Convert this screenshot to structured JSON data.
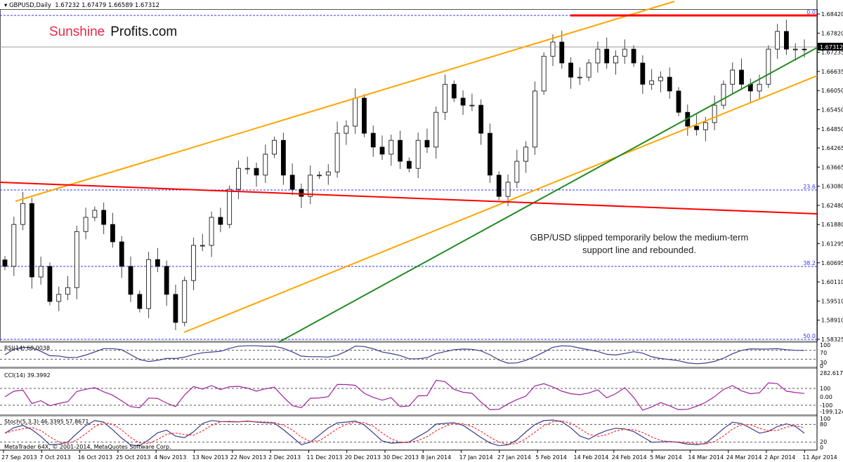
{
  "header": {
    "symbol": "GBPUSD,Daily",
    "ohlc": "1.67232 1.67479 1.66589 1.67312"
  },
  "logo": {
    "part1": "Sunshine",
    "part2": "Profits.com"
  },
  "annotation": {
    "line1": "GBP/USD slipped temporarily below  the medium-term",
    "line2": "support line and rebounded."
  },
  "price_axis": {
    "ticks": [
      "1.68420",
      "1.67820",
      "1.67235",
      "1.66635",
      "1.66050",
      "1.65450",
      "1.64850",
      "1.64265",
      "1.63665",
      "1.63080",
      "1.62480",
      "1.61880",
      "1.61295",
      "1.60695",
      "1.60110",
      "1.59510",
      "1.58910",
      "1.58325"
    ],
    "current": "1.67312"
  },
  "fib_levels": [
    "0.0",
    "23.6",
    "38.2",
    "50.0"
  ],
  "indicators": {
    "rsi": {
      "label": "RSI(14) 60.0038",
      "ticks": [
        "100",
        "70",
        "30",
        "0"
      ]
    },
    "cci": {
      "label": "CCI(14) 39.3992",
      "ticks": [
        "282.6171",
        "100",
        "0.00",
        "-100",
        "-199.1243"
      ]
    },
    "stoch": {
      "label": "Stoch(5,3,3) 46.3395 57.8671",
      "ticks": [
        "100",
        "80",
        "20",
        "0"
      ]
    }
  },
  "copyright": "MetaTrader 64X, © 2001-2014, MetaQuotes Software Corp.",
  "date_axis": [
    "27 Sep 2013",
    "7 Oct 2013",
    "16 Oct 2013",
    "25 Oct 2013",
    "4 Nov 2013",
    "13 Nov 2013",
    "22 Nov 2013",
    "2 Dec 2013",
    "11 Dec 2013",
    "20 Dec 2013",
    "30 Dec 2013",
    "8 Jan 2014",
    "17 Jan 2014",
    "27 Jan 2014",
    "5 Feb 2014",
    "14 Feb 2014",
    "24 Feb 2014",
    "5 Mar 2014",
    "14 Mar 2014",
    "24 Mar 2014",
    "2 Apr 2014",
    "11 Apr 2014"
  ],
  "chart_data": {
    "type": "candlestick",
    "title": "GBPUSD,Daily",
    "ylim": [
      1.58325,
      1.6842
    ],
    "closes": [
      1.6059,
      1.6189,
      1.6254,
      1.6026,
      1.6059,
      1.595,
      1.5972,
      1.5993,
      1.6167,
      1.6211,
      1.6233,
      1.6189,
      1.6135,
      1.6059,
      1.5972,
      1.5928,
      1.608,
      1.6059,
      1.5972,
      1.5885,
      1.6015,
      1.6124,
      1.6124,
      1.6211,
      1.6189,
      1.6298,
      1.6363,
      1.6363,
      1.6342,
      1.6407,
      1.645,
      1.6342,
      1.6298,
      1.6276,
      1.6342,
      1.6342,
      1.6352,
      1.6472,
      1.6494,
      1.6581,
      1.6472,
      1.6429,
      1.6407,
      1.645,
      1.6385,
      1.6363,
      1.645,
      1.6429,
      1.6537,
      1.6624,
      1.6581,
      1.6559,
      1.6559,
      1.6472,
      1.6342,
      1.6276,
      1.632,
      1.6385,
      1.6429,
      1.6603,
      1.6711,
      1.6755,
      1.669,
      1.6646,
      1.6646,
      1.669,
      1.6733,
      1.669,
      1.6711,
      1.6733,
      1.669,
      1.6624,
      1.6635,
      1.6646,
      1.6603,
      1.6537,
      1.6494,
      1.6483,
      1.6505,
      1.6559,
      1.6624,
      1.6668,
      1.6624,
      1.6603,
      1.6624,
      1.6733,
      1.6788,
      1.6733,
      1.6733,
      1.6731
    ]
  },
  "colors": {
    "bull": "#ffffff",
    "bear": "#000000",
    "fib": "#3333ff",
    "channel": "#ffa500",
    "support": "#228b22",
    "resistance": "#ff0000",
    "rsi": "#3a3a8a",
    "cci": "#a020a0",
    "stoch_main": "#3a3a8a",
    "stoch_signal": "#ff3030"
  }
}
